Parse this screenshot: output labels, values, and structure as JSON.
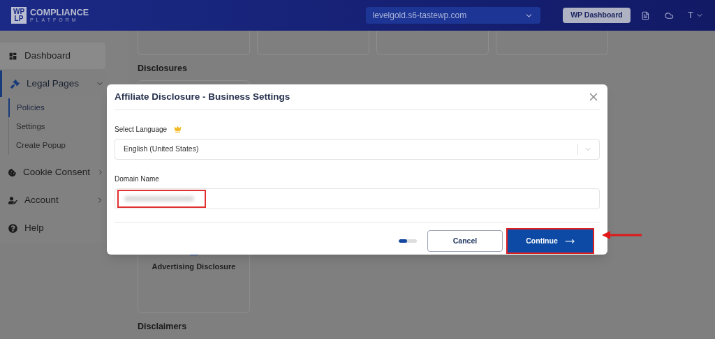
{
  "header": {
    "logo": {
      "mark_top": "WP",
      "mark_bottom": "LP",
      "name": "COMPLIANCE",
      "tagline": "PLATFORM"
    },
    "site_select": {
      "value": "levelgold.s6-tastewp.com"
    },
    "wp_dashboard_button": "WP Dashboard",
    "user_initial": "T"
  },
  "sidebar": {
    "items": [
      {
        "label": "Dashboard",
        "kind": "dashboard",
        "selected": false
      },
      {
        "label": "Legal Pages",
        "kind": "gavel",
        "selected": true,
        "expanded": true,
        "children": [
          {
            "label": "Policies",
            "selected": true
          },
          {
            "label": "Settings",
            "selected": false
          },
          {
            "label": "Create Popup",
            "selected": false
          }
        ]
      },
      {
        "label": "Cookie Consent",
        "kind": "cookie",
        "selected": false,
        "expanded": false
      },
      {
        "label": "Account",
        "kind": "account",
        "selected": false,
        "expanded": false
      },
      {
        "label": "Help",
        "kind": "help",
        "selected": false
      }
    ]
  },
  "content": {
    "sections": [
      {
        "title": "Disclosures",
        "cards": [
          {
            "title": "Advertising Disclosure"
          }
        ]
      },
      {
        "title": "Disclaimers"
      }
    ]
  },
  "modal": {
    "title": "Affiliate Disclosure - Business Settings",
    "language": {
      "label": "Select Language",
      "premium": true,
      "value": "English (United States)"
    },
    "domain": {
      "label": "Domain Name",
      "redacted": true
    },
    "progress": {
      "level": 0.45
    },
    "cancel_button": "Cancel",
    "continue_button": "Continue",
    "continue_highlighted": true
  }
}
